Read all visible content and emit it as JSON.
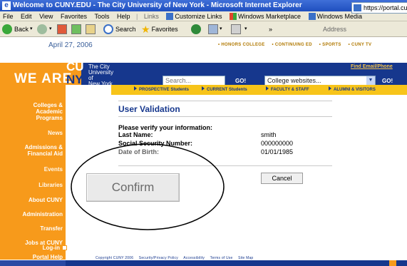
{
  "window": {
    "title": "Welcome to CUNY.EDU - The City University of New York - Microsoft Internet Explorer"
  },
  "menu": {
    "items": [
      "File",
      "Edit",
      "View",
      "Favorites",
      "Tools",
      "Help"
    ],
    "links_label": "Links",
    "links": [
      "Customize Links",
      "Windows Marketplace",
      "Windows Media"
    ]
  },
  "toolbar": {
    "back": "Back",
    "search": "Search",
    "favorites": "Favorites",
    "address_label": "Address",
    "address": "https://portal.cuny.edu/portal"
  },
  "page": {
    "date": "April 27, 2006",
    "top_links": [
      "HONORS COLLEGE",
      "CONTINUING ED",
      "SPORTS",
      "CUNY TV"
    ],
    "brand": {
      "we_are": "WE ARE",
      "cu": "CU",
      "ny": "NY",
      "name_lines": [
        "The City",
        "University",
        "of",
        "New York"
      ]
    },
    "find_email": "Find Email/Phone",
    "search_placeholder": "Search...",
    "go": "GO!",
    "college_select": "College websites...",
    "tabs": [
      "PROSPECTIVE Students",
      "CURRENT Students",
      "FACULTY & STAFF",
      "ALUMNI & VISITORS"
    ],
    "sidebar": [
      "Colleges &",
      "Academic",
      "Programs",
      "News",
      "Admissions &",
      "Financial Aid",
      "Events",
      "Libraries",
      "About CUNY",
      "Administration",
      "Transfer",
      "Jobs at CUNY",
      "Portal Help",
      "Log-in"
    ],
    "footer": [
      "Copyright CUNY 2006",
      "Security/Privacy Policy",
      "Accessibility",
      "Terms of Use",
      "Site Map"
    ]
  },
  "validation": {
    "title": "User Validation",
    "prompt": "Please verify your information:",
    "last_name_label": "Last Name:",
    "last_name_value": "smith",
    "ssn_label": "Social Security Number:",
    "ssn_value": "000000000",
    "dob_label": "Date of Birth:",
    "dob_value": "01/01/1985",
    "cancel": "Cancel",
    "confirm": "Confirm"
  }
}
